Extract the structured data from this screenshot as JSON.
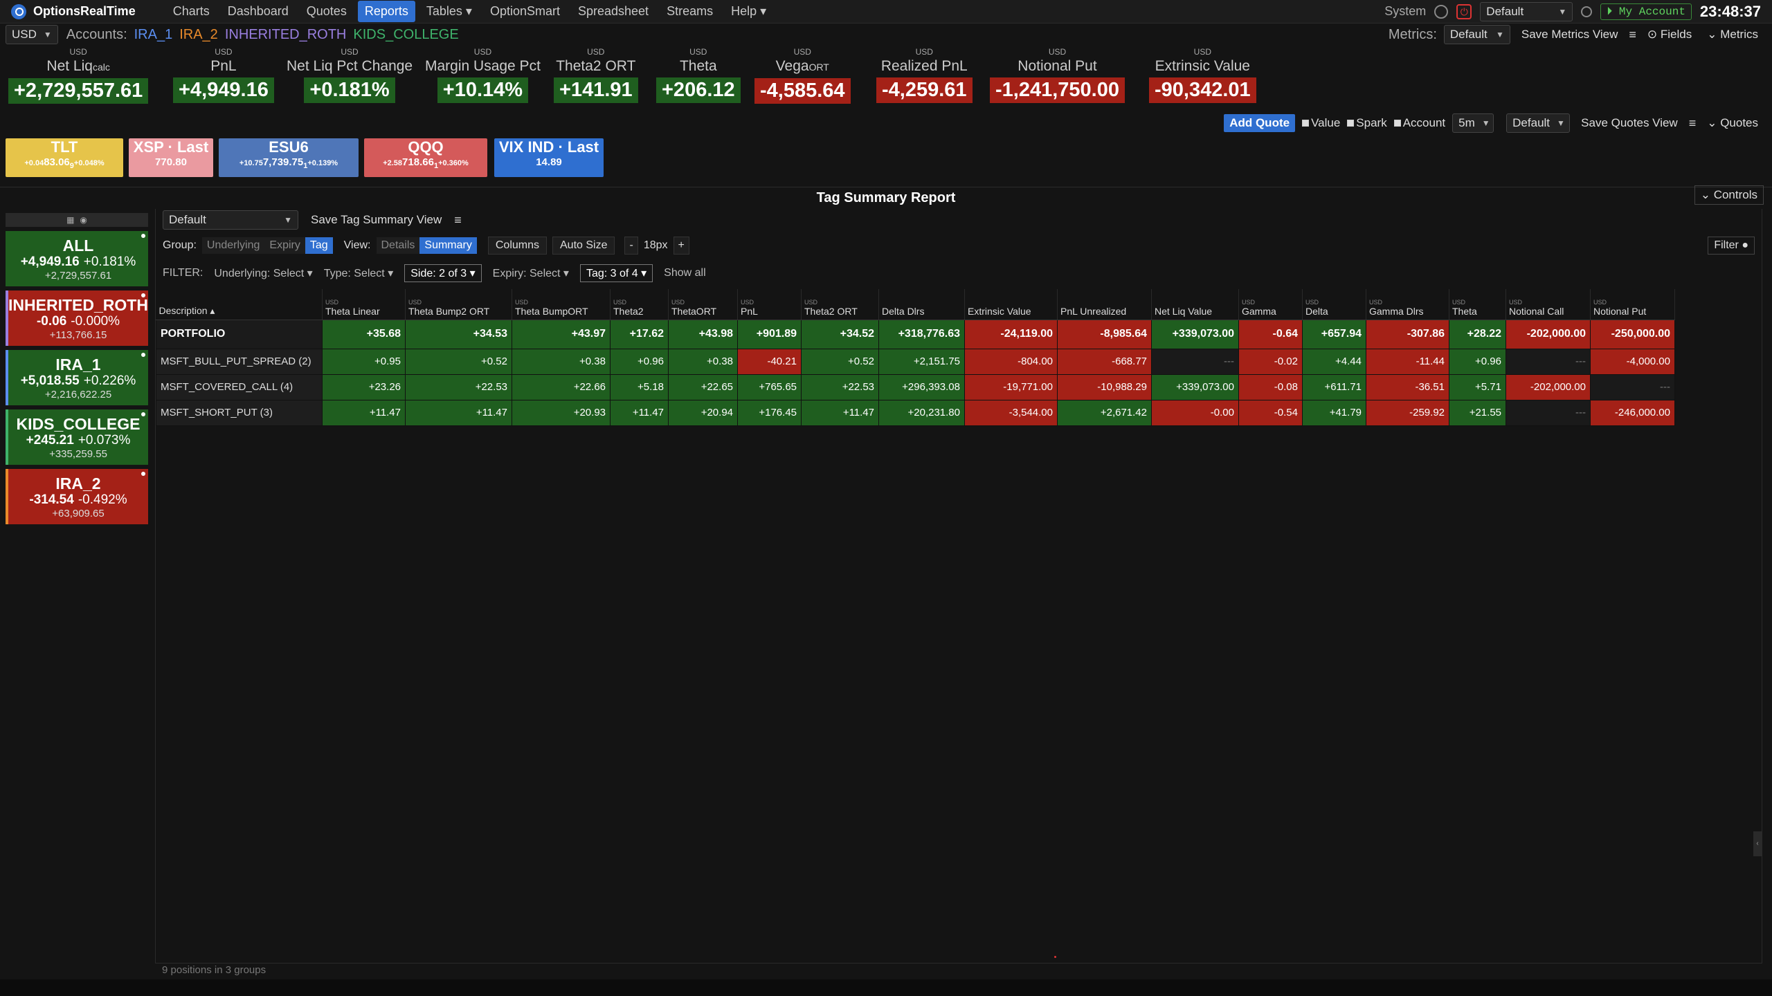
{
  "app": {
    "name": "OptionsRealTime"
  },
  "nav": [
    "Charts",
    "Dashboard",
    "Quotes",
    "Reports",
    "Tables ▾",
    "OptionSmart",
    "Spreadsheet",
    "Streams",
    "Help ▾"
  ],
  "topright": {
    "system": "System",
    "profile": "Default",
    "account_btn": "My Account",
    "clock": "23:48:37"
  },
  "currency": "USD",
  "accounts": {
    "label": "Accounts:",
    "items": [
      {
        "name": "IRA_1",
        "color": "#5b8ef0"
      },
      {
        "name": "IRA_2",
        "color": "#e88a2a"
      },
      {
        "name": "INHERITED_ROTH",
        "color": "#9a7fe0"
      },
      {
        "name": "KIDS_COLLEGE",
        "color": "#3fb36b"
      }
    ]
  },
  "metrics_controls": {
    "label": "Metrics:",
    "view": "Default",
    "save": "Save Metrics View",
    "fields": "Fields",
    "metrics": "Metrics"
  },
  "metrics": [
    {
      "unit": "USD",
      "name": "Net Liq",
      "sub": "calc",
      "value": "+2,729,557.61",
      "tone": "g"
    },
    {
      "unit": "USD",
      "name": "PnL",
      "sub": "",
      "value": "+4,949.16",
      "tone": "g"
    },
    {
      "unit": "USD",
      "name": "Net Liq Pct Change",
      "sub": "",
      "value": "+0.181%",
      "tone": "g"
    },
    {
      "unit": "USD",
      "name": "Margin Usage Pct",
      "sub": "",
      "value": "+10.14%",
      "tone": "g"
    },
    {
      "unit": "USD",
      "name": "Theta2 ORT",
      "sub": "",
      "value": "+141.91",
      "tone": "g"
    },
    {
      "unit": "USD",
      "name": "Theta",
      "sub": "",
      "value": "+206.12",
      "tone": "g"
    },
    {
      "unit": "USD",
      "name": "Vega",
      "sub": "ORT",
      "value": "-4,585.64",
      "tone": "r"
    },
    {
      "unit": "USD",
      "name": "Realized PnL",
      "sub": "",
      "value": "-4,259.61",
      "tone": "r"
    },
    {
      "unit": "USD",
      "name": "Notional Put",
      "sub": "",
      "value": "-1,241,750.00",
      "tone": "r"
    },
    {
      "unit": "USD",
      "name": "Extrinsic Value",
      "sub": "",
      "value": "-90,342.01",
      "tone": "r"
    }
  ],
  "quotes_controls": {
    "add": "Add Quote",
    "value": "Value",
    "spark": "Spark",
    "account": "Account",
    "interval": "5m",
    "view": "Default",
    "save": "Save Quotes View",
    "quotes": "Quotes"
  },
  "quotes": [
    {
      "name": "TLT",
      "left": "+0.04",
      "val": "83.06",
      "sub": "9",
      "right": "+0.048%",
      "color": "#e6c44a"
    },
    {
      "name": "XSP · Last",
      "left": "",
      "val": "770.80",
      "sub": "",
      "right": "",
      "color": "#ea9aa0"
    },
    {
      "name": "ESU6",
      "left": "+10.75",
      "val": "7,739.75",
      "sub": "1",
      "right": "+0.139%",
      "color": "#4f76b8"
    },
    {
      "name": "QQQ",
      "left": "+2.58",
      "val": "718.66",
      "sub": "1",
      "right": "+0.360%",
      "color": "#d45a5a"
    },
    {
      "name": "VIX IND · Last",
      "left": "",
      "val": "14.89",
      "sub": "",
      "right": "",
      "color": "#2f6fd0"
    }
  ],
  "report": {
    "title": "Tag Summary Report",
    "controls": "Controls"
  },
  "sidebar_cards": [
    {
      "name": "ALL",
      "pnl": "+4,949.16",
      "pct": "+0.181%",
      "liq": "+2,729,557.61",
      "bg": "#1f5e1f",
      "border": "#1f5e1f"
    },
    {
      "name": "INHERITED_ROTH",
      "pnl": "-0.06",
      "pct": "-0.000%",
      "liq": "+113,766.15",
      "bg": "#a42117",
      "border": "#9a7fe0"
    },
    {
      "name": "IRA_1",
      "pnl": "+5,018.55",
      "pct": "+0.226%",
      "liq": "+2,216,622.25",
      "bg": "#1f5e1f",
      "border": "#5b8ef0"
    },
    {
      "name": "KIDS_COLLEGE",
      "pnl": "+245.21",
      "pct": "+0.073%",
      "liq": "+335,259.55",
      "bg": "#1f5e1f",
      "border": "#3fb36b"
    },
    {
      "name": "IRA_2",
      "pnl": "-314.54",
      "pct": "-0.492%",
      "liq": "+63,909.65",
      "bg": "#a42117",
      "border": "#e88a2a"
    }
  ],
  "toolbar": {
    "view_select": "Default",
    "save_view": "Save Tag Summary View",
    "group_label": "Group:",
    "group_opts": [
      "Underlying",
      "Expiry",
      "Tag"
    ],
    "group_active": 2,
    "view_label": "View:",
    "view_opts": [
      "Details",
      "Summary"
    ],
    "view_active": 1,
    "columns": "Columns",
    "autosize": "Auto Size",
    "minus": "-",
    "size": "18px",
    "plus": "+",
    "filter": "Filter"
  },
  "filters": {
    "label": "FILTER:",
    "items": [
      {
        "text": "Underlying: Select ▾",
        "boxed": false
      },
      {
        "text": "Type: Select ▾",
        "boxed": false
      },
      {
        "text": "Side: 2 of 3 ▾",
        "boxed": true
      },
      {
        "text": "Expiry: Select ▾",
        "boxed": false
      },
      {
        "text": "Tag: 3 of 4 ▾",
        "boxed": true
      },
      {
        "text": "Show all",
        "boxed": false
      }
    ]
  },
  "table": {
    "columns": [
      {
        "name": "Description ▴",
        "unit": "",
        "w": 240
      },
      {
        "name": "Theta Linear",
        "unit": "USD",
        "w": 120
      },
      {
        "name": "Theta Bump2 ORT",
        "unit": "USD",
        "w": 154
      },
      {
        "name": "Theta BumpORT",
        "unit": "USD",
        "w": 142
      },
      {
        "name": "Theta2",
        "unit": "USD",
        "w": 84
      },
      {
        "name": "ThetaORT",
        "unit": "USD",
        "w": 100
      },
      {
        "name": "PnL",
        "unit": "USD",
        "w": 92
      },
      {
        "name": "Theta2 ORT",
        "unit": "USD",
        "w": 112
      },
      {
        "name": "Delta Dlrs",
        "unit": "",
        "w": 124
      },
      {
        "name": "Extrinsic Value",
        "unit": "",
        "w": 134
      },
      {
        "name": "PnL Unrealized",
        "unit": "",
        "w": 136
      },
      {
        "name": "Net Liq Value",
        "unit": "",
        "w": 126
      },
      {
        "name": "Gamma",
        "unit": "USD",
        "w": 92
      },
      {
        "name": "Delta",
        "unit": "USD",
        "w": 92
      },
      {
        "name": "Gamma Dlrs",
        "unit": "USD",
        "w": 120
      },
      {
        "name": "Theta",
        "unit": "USD",
        "w": 82
      },
      {
        "name": "Notional Call",
        "unit": "USD",
        "w": 122
      },
      {
        "name": "Notional Put",
        "unit": "USD",
        "w": 122
      }
    ],
    "rows": [
      {
        "cells": [
          "PORTFOLIO",
          "+35.68",
          "+34.53",
          "+43.97",
          "+17.62",
          "+43.98",
          "+901.89",
          "+34.52",
          "+318,776.63",
          "-24,119.00",
          "-8,985.64",
          "+339,073.00",
          "-0.64",
          "+657.94",
          "-307.86",
          "+28.22",
          "-202,000.00",
          "-250,000.00"
        ],
        "tones": [
          "",
          "g",
          "g",
          "g",
          "g",
          "g",
          "g",
          "g",
          "g",
          "r",
          "r",
          "g",
          "r",
          "g",
          "r",
          "g",
          "r",
          "r"
        ],
        "portfolio": true
      },
      {
        "cells": [
          "MSFT_BULL_PUT_SPREAD (2)",
          "+0.95",
          "+0.52",
          "+0.38",
          "+0.96",
          "+0.38",
          "-40.21",
          "+0.52",
          "+2,151.75",
          "-804.00",
          "-668.77",
          "---",
          "-0.02",
          "+4.44",
          "-11.44",
          "+0.96",
          "---",
          "-4,000.00"
        ],
        "tones": [
          "",
          "g",
          "g",
          "g",
          "g",
          "g",
          "r",
          "g",
          "g",
          "r",
          "r",
          "n",
          "r",
          "g",
          "r",
          "g",
          "n",
          "r"
        ],
        "portfolio": false
      },
      {
        "cells": [
          "MSFT_COVERED_CALL (4)",
          "+23.26",
          "+22.53",
          "+22.66",
          "+5.18",
          "+22.65",
          "+765.65",
          "+22.53",
          "+296,393.08",
          "-19,771.00",
          "-10,988.29",
          "+339,073.00",
          "-0.08",
          "+611.71",
          "-36.51",
          "+5.71",
          "-202,000.00",
          "---"
        ],
        "tones": [
          "",
          "g",
          "g",
          "g",
          "g",
          "g",
          "g",
          "g",
          "g",
          "r",
          "r",
          "g",
          "r",
          "g",
          "r",
          "g",
          "r",
          "n"
        ],
        "portfolio": false
      },
      {
        "cells": [
          "MSFT_SHORT_PUT (3)",
          "+11.47",
          "+11.47",
          "+20.93",
          "+11.47",
          "+20.94",
          "+176.45",
          "+11.47",
          "+20,231.80",
          "-3,544.00",
          "+2,671.42",
          "-0.00",
          "-0.54",
          "+41.79",
          "-259.92",
          "+21.55",
          "---",
          "-246,000.00"
        ],
        "tones": [
          "",
          "g",
          "g",
          "g",
          "g",
          "g",
          "g",
          "g",
          "g",
          "r",
          "g",
          "r",
          "r",
          "g",
          "r",
          "g",
          "n",
          "r"
        ],
        "portfolio": false
      }
    ]
  },
  "footer": "9 positions in 3 groups"
}
